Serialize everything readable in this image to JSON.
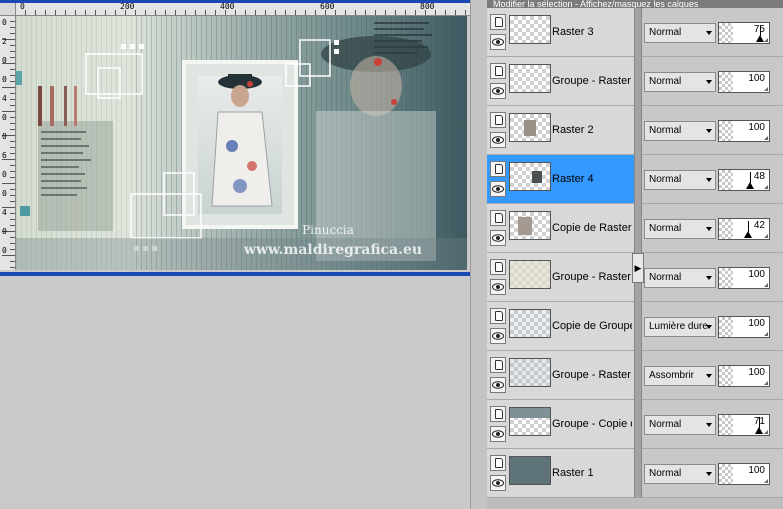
{
  "ruler_top": {
    "labels": [
      "0",
      "200",
      "400",
      "600",
      "800"
    ]
  },
  "ruler_left": {
    "labels": [
      "0",
      "2",
      "0",
      "0",
      "4",
      "0",
      "0",
      "6",
      "0",
      "0",
      "4",
      "0",
      "0"
    ]
  },
  "canvas": {
    "watermark_line1": "Pinuccia",
    "watermark_line2": "www.maldiregrafica.eu"
  },
  "layers_header": "Modifier la sélection - Affichez/masquez les calques",
  "layers": [
    {
      "name": "Raster 3",
      "blend": "Normal",
      "opacity": 75,
      "selected": false
    },
    {
      "name": "Groupe - Raster 3",
      "blend": "Normal",
      "opacity": 100,
      "selected": false
    },
    {
      "name": "Raster 2",
      "blend": "Normal",
      "opacity": 100,
      "selected": false
    },
    {
      "name": "Raster 4",
      "blend": "Normal",
      "opacity": 48,
      "selected": true
    },
    {
      "name": "Copie de Raster 2",
      "blend": "Normal",
      "opacity": 42,
      "selected": false
    },
    {
      "name": "Groupe - Raster 2",
      "blend": "Normal",
      "opacity": 100,
      "selected": false
    },
    {
      "name": "Copie de Groupe - R",
      "blend": "Lumière dure",
      "opacity": 100,
      "selected": false
    },
    {
      "name": "Groupe - Raster 2",
      "blend": "Assombrir",
      "opacity": 100,
      "selected": false
    },
    {
      "name": "Groupe - Copie de R",
      "blend": "Normal",
      "opacity": 71,
      "selected": false
    },
    {
      "name": "Raster 1",
      "blend": "Normal",
      "opacity": 100,
      "selected": false
    }
  ],
  "colors": {
    "selection": "#3399ff",
    "canvas_border": "#1a49b5"
  }
}
